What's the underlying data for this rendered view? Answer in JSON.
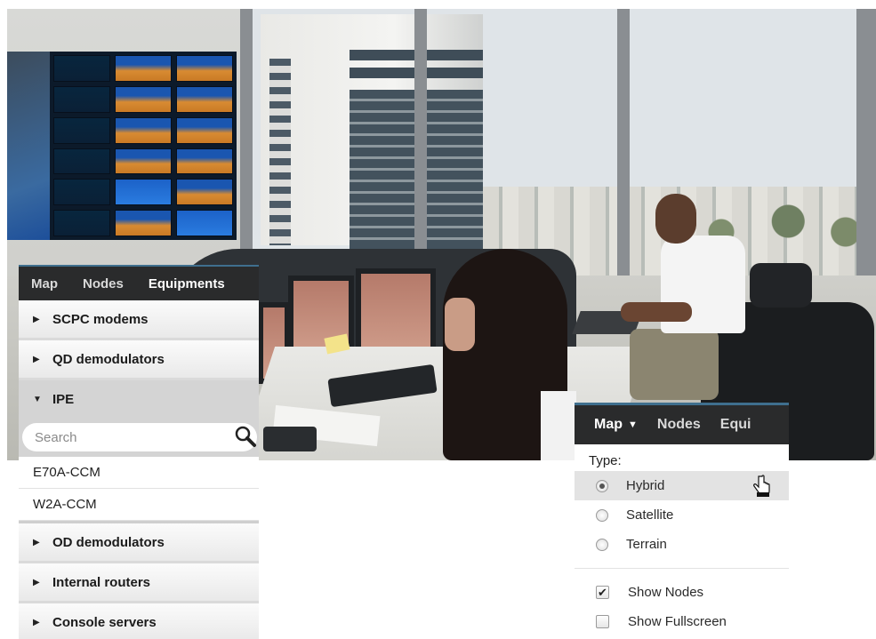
{
  "left_panel": {
    "nav": {
      "tabs": [
        {
          "label": "Map"
        },
        {
          "label": "Nodes"
        },
        {
          "label": "Equipments"
        }
      ],
      "active": "Equipments"
    },
    "sections_before": [
      {
        "label": "SCPC modems",
        "expanded": false
      },
      {
        "label": "QD demodulators",
        "expanded": false
      }
    ],
    "open_section": {
      "label": "IPE",
      "expanded": true
    },
    "search": {
      "placeholder": "Search",
      "icon": "search-icon"
    },
    "items": [
      {
        "label": "E70A-CCM"
      },
      {
        "label": "W2A-CCM"
      }
    ],
    "sections_after": [
      {
        "label": "OD demodulators",
        "expanded": false
      },
      {
        "label": "Internal routers",
        "expanded": false
      },
      {
        "label": "Console servers",
        "expanded": false
      }
    ]
  },
  "right_panel": {
    "nav": {
      "tabs": [
        {
          "label": "Map",
          "has_caret": true
        },
        {
          "label": "Nodes"
        },
        {
          "label": "Equi"
        }
      ],
      "active": "Map"
    },
    "menu": {
      "type_header": "Type:",
      "types": [
        {
          "label": "Hybrid",
          "selected": true
        },
        {
          "label": "Satellite",
          "selected": false
        },
        {
          "label": "Terrain",
          "selected": false
        }
      ],
      "options": [
        {
          "label": "Show Nodes",
          "checked": true
        },
        {
          "label": "Show Fullscreen",
          "checked": false
        }
      ]
    }
  },
  "colors": {
    "nav_bg": "#2a2b2c",
    "nav_accent": "#3f6f8e",
    "section_bg": "#ebebeb",
    "hover_bg": "#e3e3e3"
  }
}
